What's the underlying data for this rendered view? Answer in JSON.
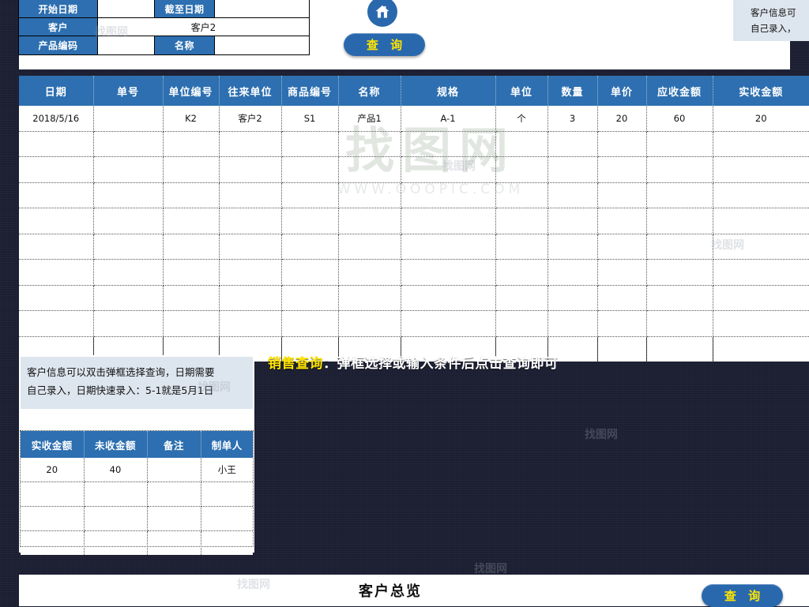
{
  "form": {
    "rows": [
      [
        {
          "type": "label",
          "text": "开始日期"
        },
        {
          "type": "input",
          "text": ""
        },
        {
          "type": "label",
          "text": "截至日期"
        },
        {
          "type": "input",
          "text": ""
        }
      ],
      [
        {
          "type": "label",
          "text": "客户"
        },
        {
          "type": "input_wide",
          "text": "客户2"
        }
      ],
      [
        {
          "type": "label",
          "text": "产品编码"
        },
        {
          "type": "input",
          "text": ""
        },
        {
          "type": "label",
          "text": "名称"
        },
        {
          "type": "input",
          "text": ""
        }
      ]
    ]
  },
  "buttons": {
    "home_icon": "home-icon",
    "query_top": "查 询",
    "query_bottom": "查 询"
  },
  "note_top": {
    "line1": "客户信息可",
    "line2": "自己录入，"
  },
  "main_table": {
    "headers": [
      "日期",
      "单号",
      "单位编号",
      "往来单位",
      "商品编号",
      "名称",
      "规格",
      "单位",
      "数量",
      "单价",
      "应收金额",
      "实收金额"
    ],
    "rows": [
      [
        "2018/5/16",
        "",
        "K2",
        "客户2",
        "S1",
        "产品1",
        "A-1",
        "个",
        "3",
        "20",
        "60",
        "20"
      ],
      [
        "",
        "",
        "",
        "",
        "",
        "",
        "",
        "",
        "",
        "",
        "",
        ""
      ],
      [
        "",
        "",
        "",
        "",
        "",
        "",
        "",
        "",
        "",
        "",
        "",
        ""
      ],
      [
        "",
        "",
        "",
        "",
        "",
        "",
        "",
        "",
        "",
        "",
        "",
        ""
      ],
      [
        "",
        "",
        "",
        "",
        "",
        "",
        "",
        "",
        "",
        "",
        "",
        ""
      ],
      [
        "",
        "",
        "",
        "",
        "",
        "",
        "",
        "",
        "",
        "",
        "",
        ""
      ],
      [
        "",
        "",
        "",
        "",
        "",
        "",
        "",
        "",
        "",
        "",
        "",
        ""
      ],
      [
        "",
        "",
        "",
        "",
        "",
        "",
        "",
        "",
        "",
        "",
        "",
        ""
      ],
      [
        "",
        "",
        "",
        "",
        "",
        "",
        "",
        "",
        "",
        "",
        "",
        ""
      ],
      [
        "",
        "",
        "",
        "",
        "",
        "",
        "",
        "",
        "",
        "",
        "",
        ""
      ]
    ]
  },
  "annotation": {
    "highlight": "销售查询",
    "rest": "：弹框选择或输入条件后点击查询即可"
  },
  "note_panel": {
    "line1": "客户信息可以双击弹框选择查询，日期需要",
    "line2": "自己录入，日期快速录入：5-1就是5月1日"
  },
  "mini_table": {
    "headers": [
      "实收金额",
      "未收金额",
      "备注",
      "制单人"
    ],
    "rows": [
      [
        "20",
        "40",
        "",
        "小王"
      ],
      [
        "",
        "",
        "",
        ""
      ],
      [
        "",
        "",
        "",
        ""
      ],
      [
        "",
        "",
        "",
        ""
      ]
    ]
  },
  "bottom": {
    "title": "客户总览"
  },
  "watermark": {
    "big": "找图网",
    "sub": "WWW.OOOPIC.COM",
    "mark": "找图网"
  },
  "colors": {
    "header_blue": "#2d6fb0",
    "button_blue": "#2a68ad",
    "button_text": "#ffe400",
    "note_bg": "#dde5ee",
    "page_bg": "#1b1e31"
  }
}
